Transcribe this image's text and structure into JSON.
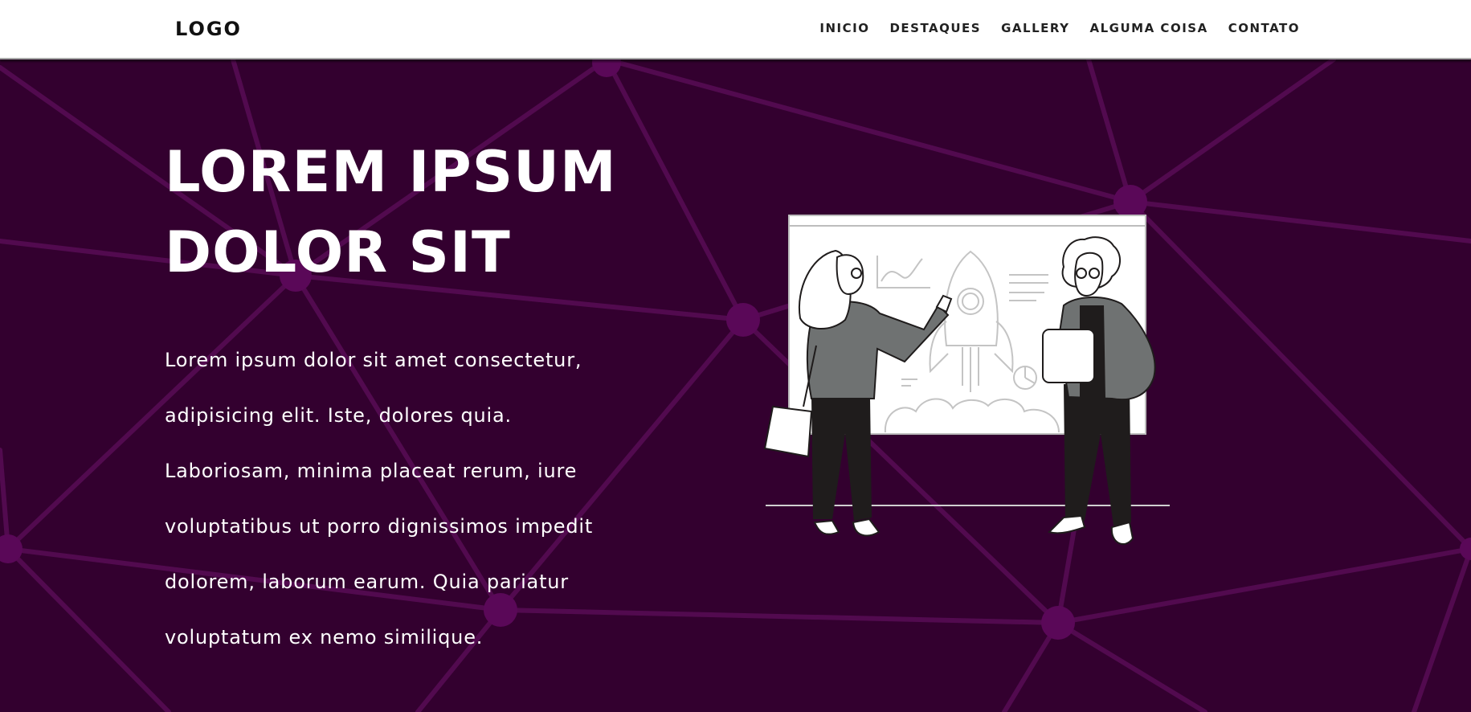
{
  "header": {
    "logo": "LOGO",
    "nav": [
      "INICIO",
      "DESTAQUES",
      "GALLERY",
      "ALGUMA COISA",
      "CONTATO"
    ]
  },
  "hero": {
    "title_line1": "LOREM IPSUM",
    "title_line2": "DOLOR SIT",
    "paragraph": "Lorem ipsum dolor sit amet consectetur, adipisicing elit. Iste, dolores quia. Laboriosam, minima placeat rerum, iure voluptatibus ut porro dignissimos impedit dolorem, laborum earum. Quia pariatur voluptatum ex nemo similique."
  },
  "colors": {
    "background": "#33002f",
    "network_line": "#520a4f",
    "network_node": "#5a0858",
    "text": "#ffffff",
    "header_bg": "#ffffff",
    "figure_sweater": "#6f7272",
    "figure_pants": "#1f1c1c"
  },
  "icons": [
    "network-background",
    "presentation-illustration"
  ]
}
